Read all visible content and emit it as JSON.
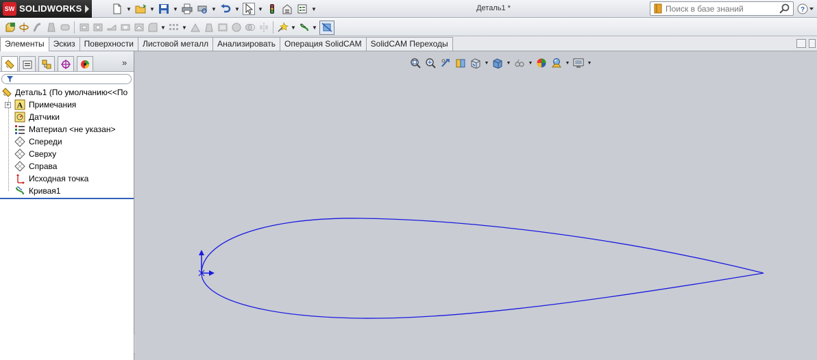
{
  "app": {
    "brand_badge": "SW",
    "brand_name": "SOLIDWORKS",
    "document_title": "Деталь1 *"
  },
  "search": {
    "placeholder": "Поиск в базе знаний"
  },
  "tabs": [
    {
      "label": "Элементы",
      "active": true
    },
    {
      "label": "Эскиз"
    },
    {
      "label": "Поверхности"
    },
    {
      "label": "Листовой металл"
    },
    {
      "label": "Анализировать"
    },
    {
      "label": "Операция  SolidCAM"
    },
    {
      "label": "SolidCAM Переходы"
    }
  ],
  "feature_tree": {
    "root": "Деталь1  (По умолчанию<<По",
    "items": [
      {
        "label": "Примечания",
        "icon": "annotations-icon"
      },
      {
        "label": "Датчики",
        "icon": "sensors-icon"
      },
      {
        "label": "Материал <не указан>",
        "icon": "material-icon"
      },
      {
        "label": "Спереди",
        "icon": "plane-icon"
      },
      {
        "label": "Сверху",
        "icon": "plane-icon"
      },
      {
        "label": "Справа",
        "icon": "plane-icon"
      },
      {
        "label": "Исходная точка",
        "icon": "origin-icon"
      },
      {
        "label": "Кривая1",
        "icon": "curve-icon"
      }
    ]
  },
  "panel": {
    "more_label": "»"
  },
  "colors": {
    "curve": "#1a1ae0",
    "viewport_bg": "#c9ccd3",
    "rollback_bar": "#2f62b8"
  }
}
